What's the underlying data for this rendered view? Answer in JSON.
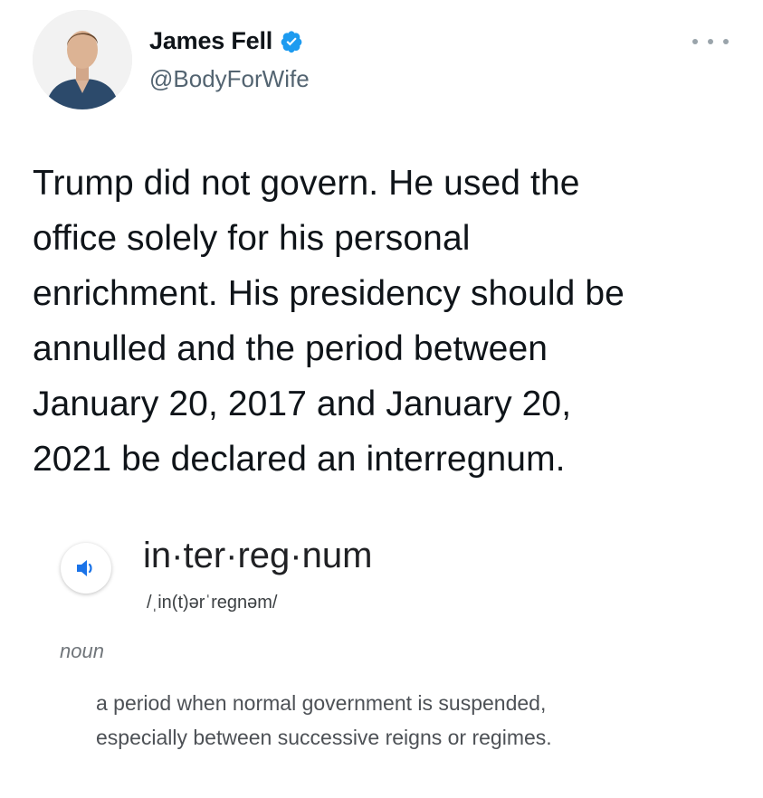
{
  "author": {
    "name": "James Fell",
    "handle": "@BodyForWife",
    "verified": true,
    "avatar_icon": "person-avatar",
    "verified_icon": "verified-badge-icon",
    "verified_color": "#1d9bf0"
  },
  "more_icon": "more-options-icon",
  "tweet": {
    "lines": [
      "Trump did not govern. He used the",
      "office solely for his personal",
      "enrichment. His presidency should be",
      "annulled and the period between",
      "January 20, 2017 and January 20,",
      "2021 be declared an interregnum."
    ]
  },
  "dictionary": {
    "speaker_icon": "speaker-icon",
    "word": "in·ter·reg·num",
    "pronunciation": "/ˌin(t)ərˈreɡnəm/",
    "part_of_speech": "noun",
    "definition_lines": [
      "a period when normal government is suspended,",
      "especially between successive reigns or regimes."
    ],
    "accent_color": "#1a73e8"
  }
}
